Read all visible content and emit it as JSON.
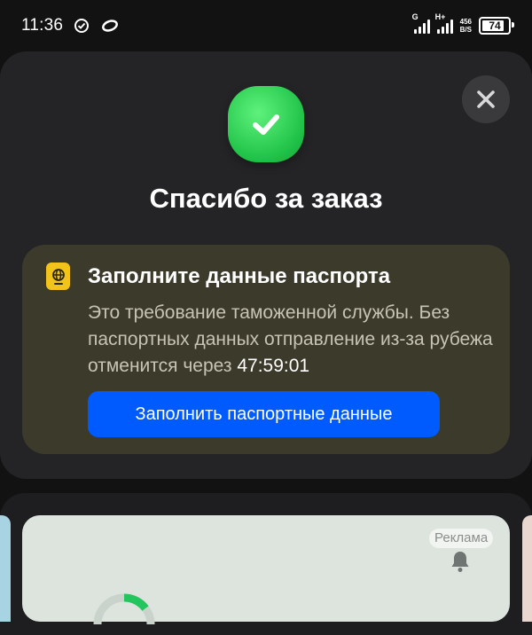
{
  "status_bar": {
    "time": "11:36",
    "network_1": "G",
    "network_2": "H+",
    "speed_value": "456",
    "speed_unit": "B/S",
    "battery": "74"
  },
  "dialog": {
    "title": "Спасибо за заказ",
    "success_color": "#1fc147"
  },
  "passport_notice": {
    "title": "Заполните данные паспорта",
    "description": "Это требование таможенной службы. Без паспортных данных отправление из-за рубежа отменится через",
    "timer": "47:59:01",
    "button_label": "Заполнить паспортные данные",
    "button_color": "#005bff"
  },
  "ad": {
    "label": "Реклама"
  }
}
